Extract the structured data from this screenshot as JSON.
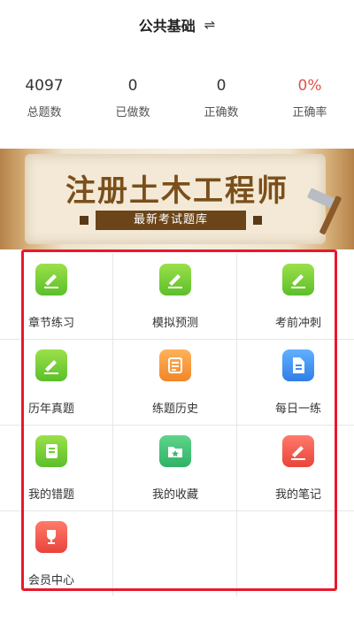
{
  "header": {
    "title": "公共基础",
    "switch_icon": "⇌"
  },
  "stats": [
    {
      "value": "4097",
      "label": "总题数",
      "highlight": false
    },
    {
      "value": "0",
      "label": "已做数",
      "highlight": false
    },
    {
      "value": "0",
      "label": "正确数",
      "highlight": false
    },
    {
      "value": "0%",
      "label": "正确率",
      "highlight": true
    }
  ],
  "banner": {
    "title": "注册土木工程师",
    "subtitle": "最新考试题库"
  },
  "menu": [
    {
      "label": "章节练习",
      "icon": "pencil-icon",
      "color": "green"
    },
    {
      "label": "模拟预测",
      "icon": "pencil-icon",
      "color": "green"
    },
    {
      "label": "考前冲刺",
      "icon": "pencil-icon",
      "color": "green"
    },
    {
      "label": "历年真题",
      "icon": "pencil-icon",
      "color": "green"
    },
    {
      "label": "练题历史",
      "icon": "list-icon",
      "color": "orange"
    },
    {
      "label": "每日一练",
      "icon": "document-icon",
      "color": "blue"
    },
    {
      "label": "我的错题",
      "icon": "notebook-icon",
      "color": "green"
    },
    {
      "label": "我的收藏",
      "icon": "star-folder-icon",
      "color": "teal"
    },
    {
      "label": "我的笔记",
      "icon": "pencil-icon",
      "color": "red"
    },
    {
      "label": "会员中心",
      "icon": "trophy-icon",
      "color": "red"
    }
  ],
  "colors": {
    "accent_red": "#e0524a",
    "frame_red": "#e8192c",
    "banner_brown": "#7a4f1b"
  }
}
